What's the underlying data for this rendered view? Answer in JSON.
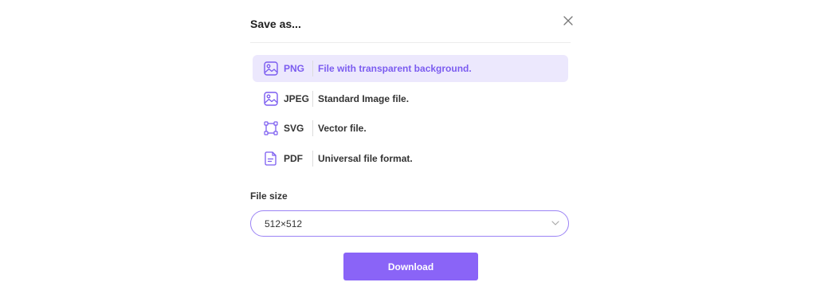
{
  "dialog": {
    "title": "Save as...",
    "close_icon": "close-icon"
  },
  "formats": [
    {
      "name": "PNG",
      "description": "File with transparent background.",
      "icon": "image-icon",
      "selected": true
    },
    {
      "name": "JPEG",
      "description": "Standard Image file.",
      "icon": "image-icon",
      "selected": false
    },
    {
      "name": "SVG",
      "description": "Vector file.",
      "icon": "vector-icon",
      "selected": false
    },
    {
      "name": "PDF",
      "description": "Universal file format.",
      "icon": "document-icon",
      "selected": false
    }
  ],
  "file_size": {
    "label": "File size",
    "value": "512×512"
  },
  "download": {
    "label": "Download"
  },
  "colors": {
    "accent": "#8a64f7",
    "selected_bg": "#ece8fd",
    "selected_text": "#7b5cf0"
  }
}
